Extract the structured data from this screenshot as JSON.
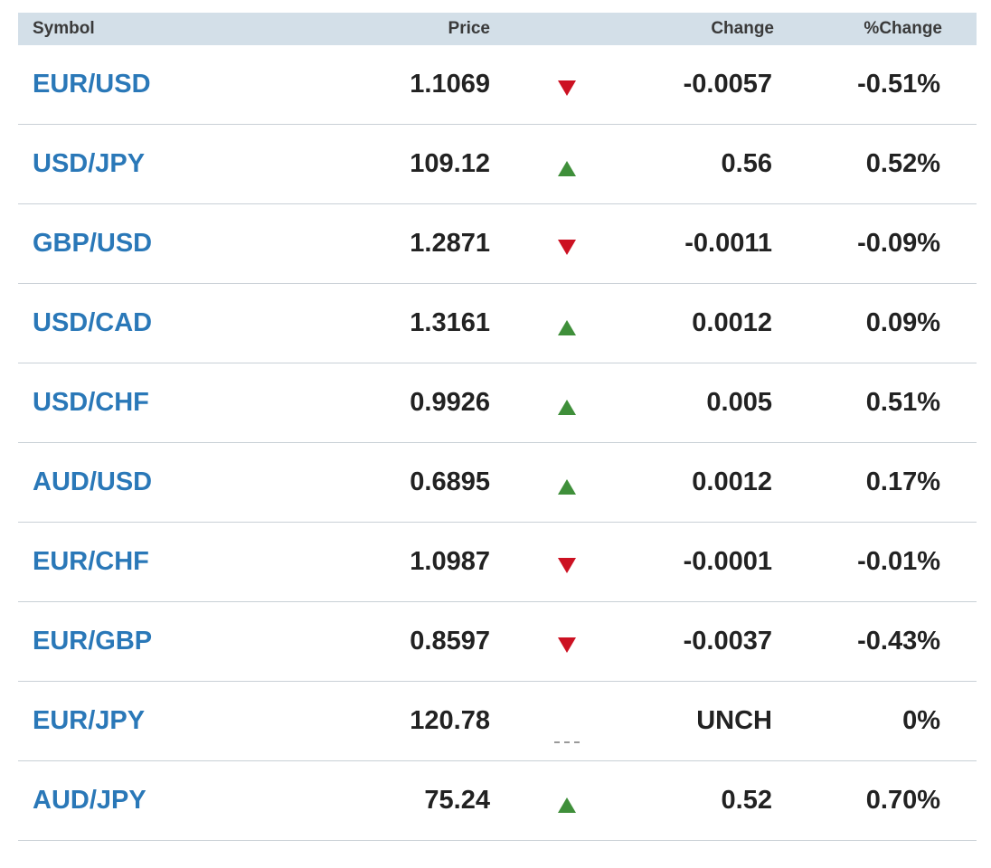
{
  "header": {
    "symbol": "Symbol",
    "price": "Price",
    "change": "Change",
    "pct_change": "%Change"
  },
  "colors": {
    "header_bg": "#d3dfe8",
    "symbol_link": "#2a78b8",
    "down": "#cc1122",
    "up": "#3f8f3a",
    "unchanged": "#999999"
  },
  "rows": [
    {
      "symbol": "EUR/USD",
      "price": "1.1069",
      "direction": "down",
      "change": "-0.0057",
      "pct_change": "-0.51%"
    },
    {
      "symbol": "USD/JPY",
      "price": "109.12",
      "direction": "up",
      "change": "0.56",
      "pct_change": "0.52%"
    },
    {
      "symbol": "GBP/USD",
      "price": "1.2871",
      "direction": "down",
      "change": "-0.0011",
      "pct_change": "-0.09%"
    },
    {
      "symbol": "USD/CAD",
      "price": "1.3161",
      "direction": "up",
      "change": "0.0012",
      "pct_change": "0.09%"
    },
    {
      "symbol": "USD/CHF",
      "price": "0.9926",
      "direction": "up",
      "change": "0.005",
      "pct_change": "0.51%"
    },
    {
      "symbol": "AUD/USD",
      "price": "0.6895",
      "direction": "up",
      "change": "0.0012",
      "pct_change": "0.17%"
    },
    {
      "symbol": "EUR/CHF",
      "price": "1.0987",
      "direction": "down",
      "change": "-0.0001",
      "pct_change": "-0.01%"
    },
    {
      "symbol": "EUR/GBP",
      "price": "0.8597",
      "direction": "down",
      "change": "-0.0037",
      "pct_change": "-0.43%"
    },
    {
      "symbol": "EUR/JPY",
      "price": "120.78",
      "direction": "unchanged",
      "change": "UNCH",
      "pct_change": "0%"
    },
    {
      "symbol": "AUD/JPY",
      "price": "75.24",
      "direction": "up",
      "change": "0.52",
      "pct_change": "0.70%"
    }
  ]
}
